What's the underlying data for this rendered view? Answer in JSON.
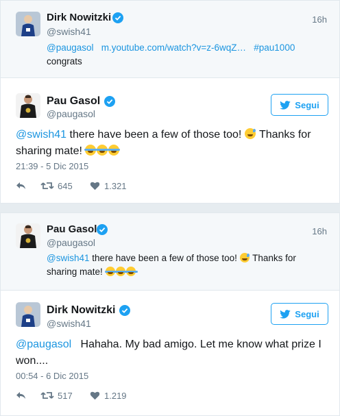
{
  "colors": {
    "accent": "#1da1f2",
    "link": "#1b95e0",
    "muted": "#657786",
    "text": "#14171a"
  },
  "block1": {
    "context": {
      "name": "Dirk Nowitzki",
      "handle": "@swish41",
      "time": "16h",
      "mention": "@paugasol",
      "url": "m.youtube.com/watch?v=z-6wqZ…",
      "hashtag": "#pau1000",
      "text": "congrats"
    },
    "tweet": {
      "name": "Pau Gasol",
      "handle": "@paugasol",
      "follow_label": "Segui",
      "mention": "@swish41",
      "text_a": " there have been a few of those too! ",
      "text_b": " Thanks for sharing mate! ",
      "timestamp": "21:39 - 5 Dic 2015",
      "retweets": "645",
      "likes": "1.321"
    }
  },
  "block2": {
    "context": {
      "name": "Pau Gasol",
      "handle": "@paugasol",
      "time": "16h",
      "mention": "@swish41",
      "text_a": " there have been a few of those too! ",
      "text_b": " Thanks for sharing mate! "
    },
    "tweet": {
      "name": "Dirk Nowitzki",
      "handle": "@swish41",
      "follow_label": "Segui",
      "mention": "@paugasol",
      "text": "   Hahaha. My bad amigo. Let me know what prize I won....",
      "timestamp": "00:54 - 6 Dic 2015",
      "retweets": "517",
      "likes": "1.219"
    }
  }
}
